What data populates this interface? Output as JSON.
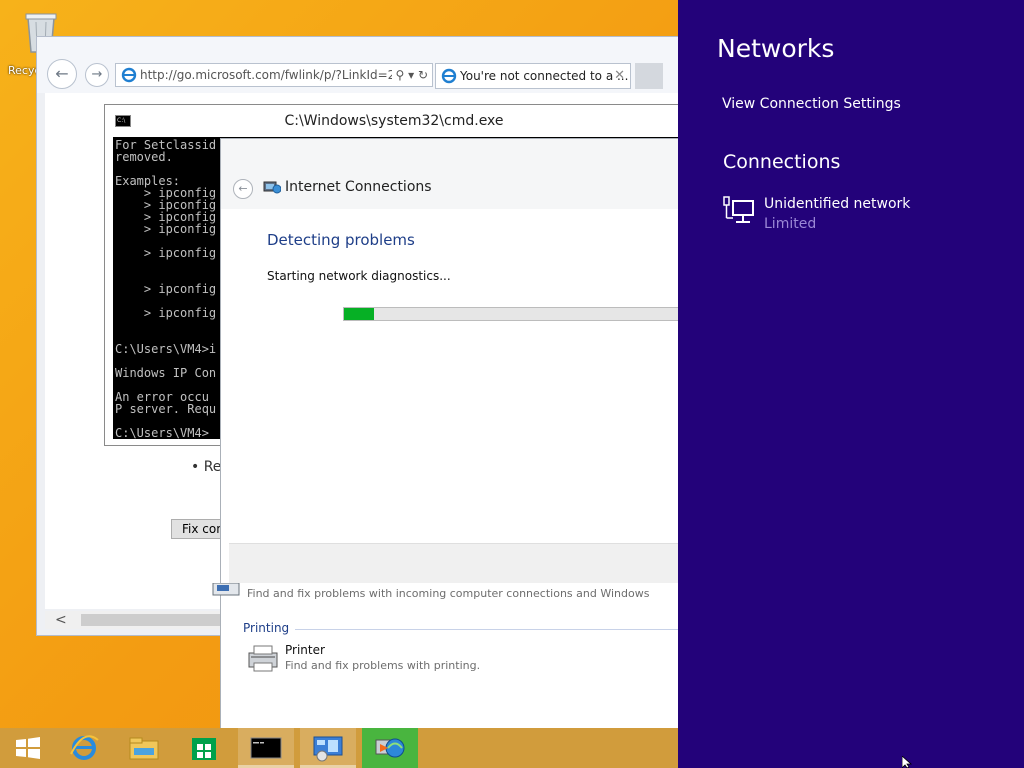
{
  "desktop": {
    "recycle_bin_label": "Recyc"
  },
  "ie": {
    "address": "http://go.microsoft.com/fwlink/p/?LinkId=2",
    "tab_title": "You're not connected to a ...",
    "tab_close": "✕",
    "back_glyph": "←",
    "forward_glyph": "→",
    "address_tools": "⚲ ▾ ↻",
    "bullet_text": "• Re",
    "fix_button": "Fix conn",
    "scroll_left": "<"
  },
  "cmd": {
    "title": "C:\\Windows\\system32\\cmd.exe",
    "lines": "For Setclassid\nremoved.\n\nExamples:\n    > ipconfig\n    > ipconfig\n    > ipconfig\n    > ipconfig\n\n    > ipconfig\n\n\n    > ipconfig\n\n    > ipconfig\n\n\nC:\\Users\\VM4>i\n\nWindows IP Con\n\nAn error occu\nP server. Requ\n\nC:\\Users\\VM4>"
  },
  "troubleshooter": {
    "window_title": "Internet Connections",
    "heading": "Detecting problems",
    "status": "Starting network diagnostics...",
    "progress_fraction": 0.09,
    "incoming_desc": "Find and fix problems with incoming computer connections and Windows",
    "section_printing": "Printing",
    "printer_name": "Printer",
    "printer_desc": "Find and fix problems with printing."
  },
  "charm": {
    "title": "Networks",
    "view_settings": "View Connection Settings",
    "connections_heading": "Connections",
    "network_name": "Unidentified network",
    "network_status": "Limited",
    "bg_color": "#23027a"
  },
  "taskbar": {
    "items": [
      {
        "name": "start-button-icon"
      },
      {
        "name": "internet-explorer-icon"
      },
      {
        "name": "file-explorer-icon"
      },
      {
        "name": "store-icon"
      },
      {
        "name": "command-prompt-icon"
      },
      {
        "name": "control-panel-icon"
      },
      {
        "name": "network-troubleshooter-icon"
      }
    ]
  }
}
